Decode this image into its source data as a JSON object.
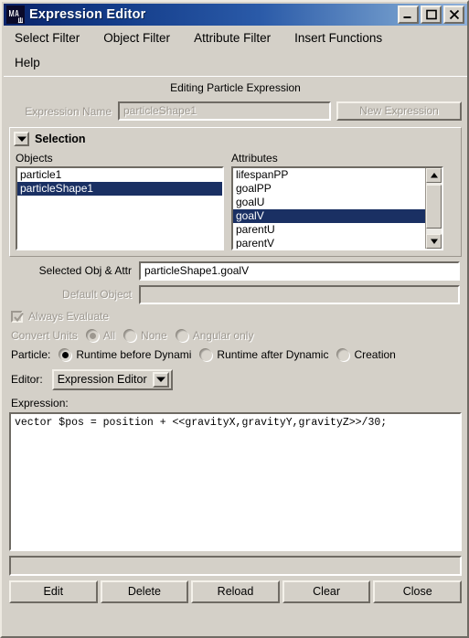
{
  "window": {
    "title": "Expression Editor",
    "icon": "maya-logo-icon",
    "minimize_label": "_",
    "maximize_label": "□",
    "close_label": "✕",
    "bg_color": "#d4d0c8",
    "title_gradient_start": "#0a246a",
    "title_gradient_end": "#8fb0da",
    "selection_color": "#1a3063"
  },
  "menubar": {
    "row1": [
      {
        "label": "Select Filter"
      },
      {
        "label": "Object Filter"
      },
      {
        "label": "Attribute Filter"
      },
      {
        "label": "Insert Functions"
      }
    ],
    "row2": [
      {
        "label": "Help"
      }
    ]
  },
  "main": {
    "editing_title": "Editing Particle Expression",
    "expression_name": {
      "label": "Expression Name",
      "value": "particleShape1",
      "placeholder": "",
      "enabled": false
    },
    "new_expression_button": {
      "label": "New Expression",
      "enabled": false
    },
    "selection_group": {
      "title": "Selection",
      "collapse_icon": "triangle-down-icon",
      "objects": {
        "label": "Objects",
        "items": [
          {
            "label": "particle1",
            "selected": false
          },
          {
            "label": "particleShape1",
            "selected": true
          }
        ]
      },
      "attributes": {
        "label": "Attributes",
        "items": [
          {
            "label": "lifespanPP",
            "selected": false
          },
          {
            "label": "goalPP",
            "selected": false
          },
          {
            "label": "goalU",
            "selected": false
          },
          {
            "label": "goalV",
            "selected": true
          },
          {
            "label": "parentU",
            "selected": false
          },
          {
            "label": "parentV",
            "selected": false
          }
        ],
        "scrollbar": {
          "up_icon": "scroll-up-arrow-icon",
          "down_icon": "scroll-down-arrow-icon"
        }
      }
    },
    "selected_obj_attr": {
      "label": "Selected Obj & Attr",
      "value": "particleShape1.goalV",
      "enabled": true
    },
    "default_object": {
      "label": "Default Object",
      "value": "",
      "enabled": false
    },
    "always_evaluate": {
      "label": "Always Evaluate",
      "checked": true,
      "enabled": false
    },
    "convert_units": {
      "label": "Convert Units",
      "enabled": false,
      "options": [
        {
          "label": "All",
          "selected": true
        },
        {
          "label": "None",
          "selected": false
        },
        {
          "label": "Angular only",
          "selected": false
        }
      ]
    },
    "particle": {
      "label": "Particle:",
      "enabled": true,
      "options": [
        {
          "label": "Runtime before Dynami",
          "selected": true
        },
        {
          "label": "Runtime after Dynamic",
          "selected": false
        },
        {
          "label": "Creation",
          "selected": false
        }
      ]
    },
    "editor": {
      "label": "Editor:",
      "value": "Expression Editor",
      "arrow_icon": "chevron-down-icon",
      "options": [
        "Expression Editor"
      ]
    },
    "expression": {
      "label": "Expression:",
      "value": "vector $pos = position + <<gravityX,gravityY,gravityZ>>/30;"
    },
    "status_bar": {
      "value": ""
    },
    "buttons": [
      {
        "label": "Edit"
      },
      {
        "label": "Delete"
      },
      {
        "label": "Reload"
      },
      {
        "label": "Clear"
      },
      {
        "label": "Close"
      }
    ]
  }
}
